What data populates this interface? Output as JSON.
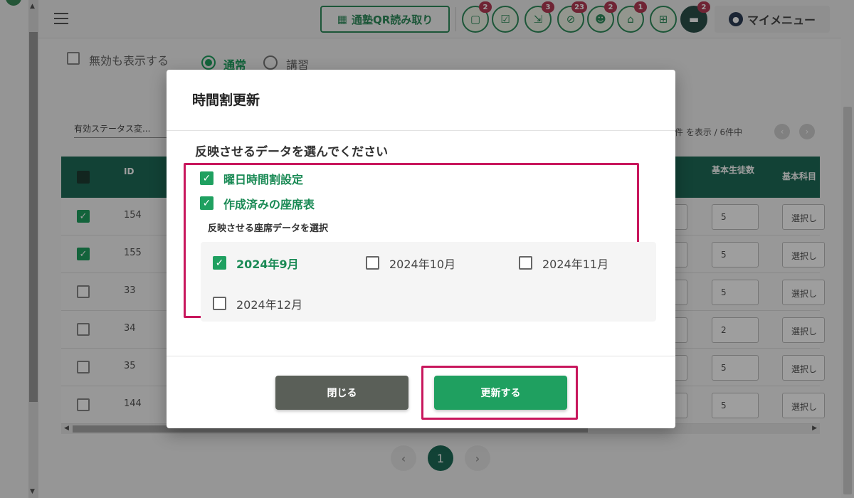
{
  "header": {
    "qr_button": "通塾QR読み取り",
    "icons": [
      {
        "name": "chat-icon",
        "glyph": "▢",
        "badge": "2"
      },
      {
        "name": "checklist-icon",
        "glyph": "☑",
        "badge": ""
      },
      {
        "name": "merge-arrows-icon",
        "glyph": "⇲",
        "badge": "3"
      },
      {
        "name": "no-location-icon",
        "glyph": "⊘",
        "badge": "23"
      },
      {
        "name": "group-icon",
        "glyph": "☻",
        "badge": "2"
      },
      {
        "name": "bank-icon",
        "glyph": "⌂",
        "badge": "1"
      },
      {
        "name": "gift-icon",
        "glyph": "⊞",
        "badge": ""
      },
      {
        "name": "message-icon",
        "glyph": "▬",
        "badge": "2"
      }
    ],
    "my_menu": "マイメニュー"
  },
  "background": {
    "show_invalid": "無効も表示する",
    "radio_normal": "通常",
    "radio_course": "講習",
    "filter_label": "有効ステータス変...",
    "page_info": "件 を表示 / 6件中",
    "columns": {
      "id": "ID",
      "base_students": "基本生徒数",
      "base_subject": "基本科目"
    },
    "rows": [
      {
        "id": "154",
        "checked": true,
        "students": "5",
        "subject": "選択し"
      },
      {
        "id": "155",
        "checked": true,
        "students": "5",
        "subject": "選択し"
      },
      {
        "id": "33",
        "checked": false,
        "students": "5",
        "subject": "選択し"
      },
      {
        "id": "34",
        "checked": false,
        "students": "2",
        "subject": "選択し"
      },
      {
        "id": "35",
        "checked": false,
        "students": "5",
        "subject": "選択し"
      },
      {
        "id": "144",
        "checked": false,
        "students": "5",
        "subject": "選択し"
      }
    ],
    "pagination": {
      "current": "1",
      "prev": "‹",
      "next": "›"
    }
  },
  "modal": {
    "title": "時間割更新",
    "subtitle": "反映させるデータを選んでください",
    "option_weekly": "曜日時間割設定",
    "option_seating": "作成済みの座席表",
    "seat_select_label": "反映させる座席データを選択",
    "months": [
      {
        "label": "2024年9月",
        "checked": true
      },
      {
        "label": "2024年10月",
        "checked": false
      },
      {
        "label": "2024年11月",
        "checked": false
      },
      {
        "label": "2024年12月",
        "checked": false
      }
    ],
    "close_button": "閉じる",
    "update_button": "更新する"
  },
  "colors": {
    "accent_green": "#1fa060",
    "highlight": "#c8175d",
    "table_header": "#1e6b57"
  }
}
